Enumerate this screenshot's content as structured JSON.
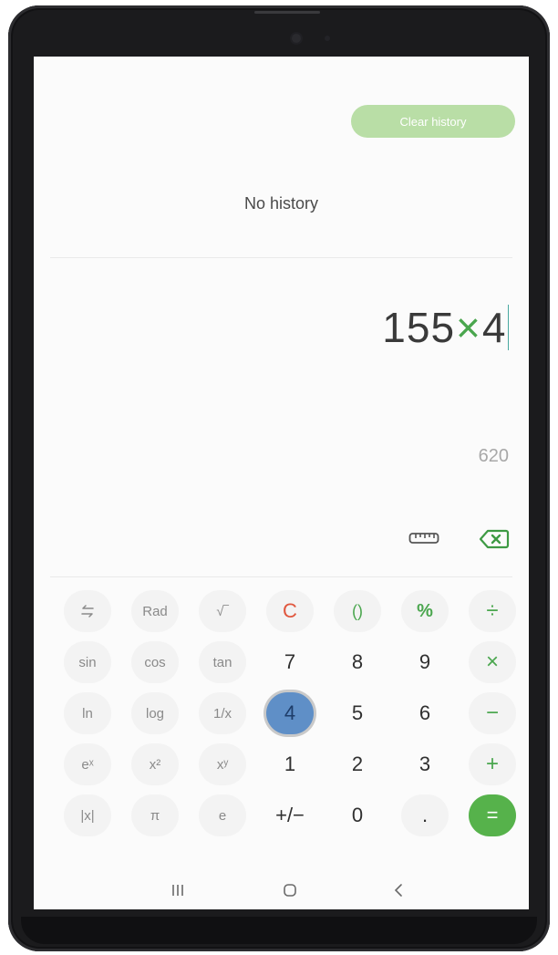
{
  "history": {
    "clear_label": "Clear history",
    "empty_label": "No history"
  },
  "display": {
    "operand1": "155",
    "operator": "×",
    "operand2": "4",
    "preview_result": "620"
  },
  "icons": {
    "ruler": "ruler-icon",
    "backspace": "backspace-icon",
    "swap": "swap-icon",
    "nav_recents": "recents-icon",
    "nav_home": "home-icon",
    "nav_back": "back-icon"
  },
  "keypad": {
    "row1": [
      "⇆",
      "Rad",
      "√‾",
      "C",
      "()",
      "%",
      "÷"
    ],
    "row2": [
      "sin",
      "cos",
      "tan",
      "7",
      "8",
      "9",
      "×"
    ],
    "row3": [
      "ln",
      "log",
      "1/x",
      "4",
      "5",
      "6",
      "−"
    ],
    "row4": [
      "eˣ",
      "x²",
      "xʸ",
      "1",
      "2",
      "3",
      "+"
    ],
    "row5": [
      "|x|",
      "π",
      "e",
      "+/−",
      "0",
      ".",
      "="
    ]
  },
  "colors": {
    "accent_green": "#4aa64e",
    "clear_red": "#e0563d",
    "equals_bg": "#56b24b",
    "clear_history_bg": "#b9dea6",
    "pressed_key": "#5f8fc7"
  }
}
